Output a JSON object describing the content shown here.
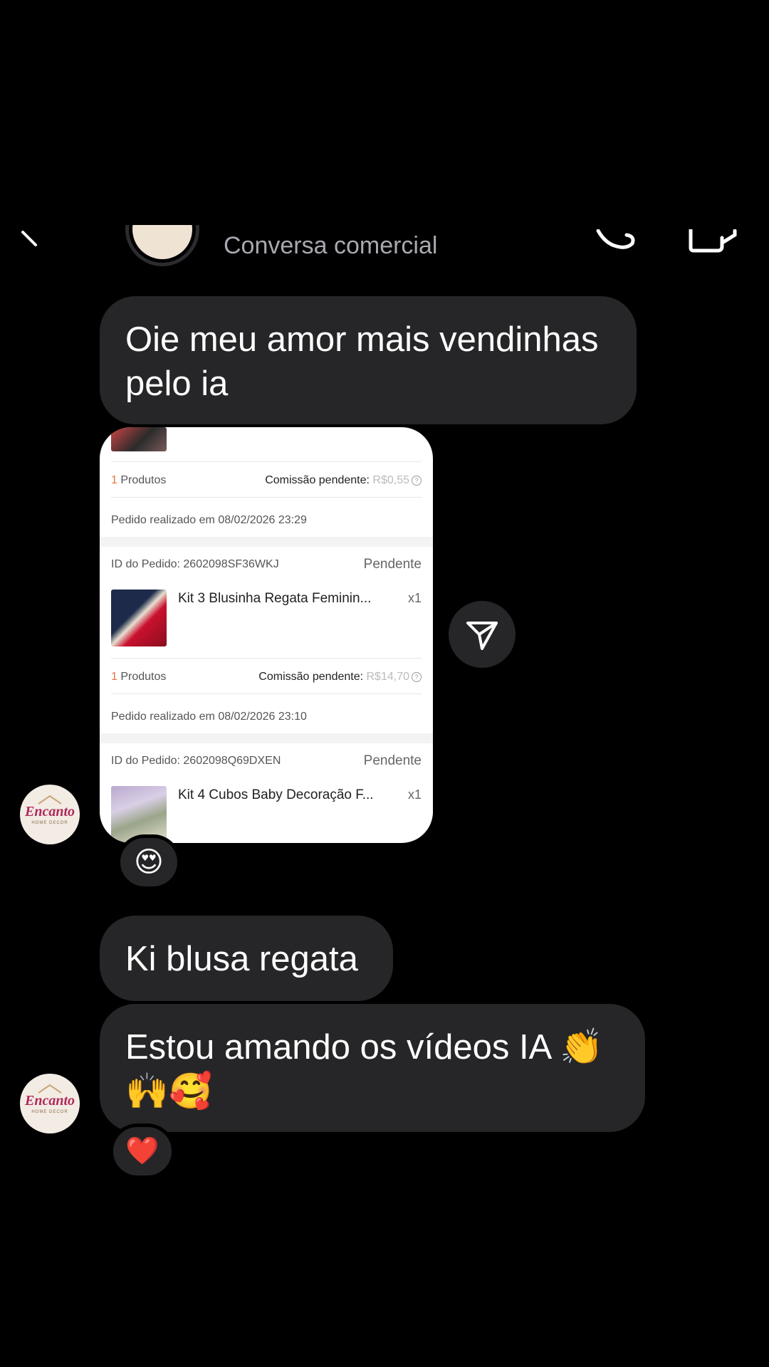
{
  "header": {
    "subtitle": "Conversa comercial",
    "icons": [
      "back-icon",
      "phone-icon",
      "video-camera-icon"
    ]
  },
  "messages": [
    {
      "text": "Oie meu amor mais vendinhas pelo ia"
    },
    {
      "text": "Ki blusa regata"
    },
    {
      "text": "Estou amando os vídeos IA 👏🙌🥰"
    }
  ],
  "card": {
    "block1": {
      "products_count": "1",
      "products_label": " Produtos",
      "commission_label": "Comissão pendente: ",
      "commission_value": "R$0,55",
      "order_date": "Pedido realizado em 08/02/2026 23:29"
    },
    "block2": {
      "order_id": "ID do Pedido: 2602098SF36WKJ",
      "status": "Pendente",
      "product_name": "Kit 3 Blusinha Regata Feminin...",
      "qty": "x1",
      "products_count": "1",
      "products_label": " Produtos",
      "commission_label": "Comissão pendente: ",
      "commission_value": "R$14,70",
      "order_date": "Pedido realizado em 08/02/2026 23:10"
    },
    "block3": {
      "order_id": "ID do Pedido: 2602098Q69DXEN",
      "status": "Pendente",
      "product_name": "Kit 4 Cubos Baby Decoração F...",
      "qty": "x1"
    }
  },
  "reactions": [
    "😍",
    "❤️"
  ],
  "avatar": {
    "logo_text": "Encanto",
    "tagline": "HOME DECOR"
  },
  "colors": {
    "background": "#000000",
    "bubble": "#262628",
    "accent_orange": "#e8763a",
    "header_subtitle": "#a8a8b0"
  }
}
